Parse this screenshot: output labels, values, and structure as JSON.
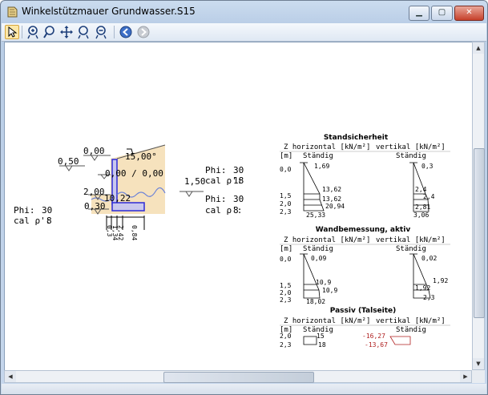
{
  "window": {
    "title": "Winkelstützmauer Grundwasser.S15",
    "min": "▁",
    "max": "▢",
    "close": "✕"
  },
  "toolbar": {
    "tools": [
      "select-tool",
      "zoom-in-tool",
      "zoom-tool",
      "pan-tool",
      "zoom-window-tool",
      "zoom-out-tool",
      "back-tool",
      "forward-tool"
    ]
  },
  "drawing": {
    "levels": {
      "left_top": "0,50",
      "wall_top": "0,00",
      "slope": "15,00°",
      "gw_mid": "0,00 / 0,00",
      "right_gw": "1,50",
      "left_gw": "2,00",
      "base_left": "0,30",
      "base_width": "10,22"
    },
    "soil_right": {
      "phi_label": "Phi:",
      "phi": "30",
      "rho_label": "cal ρ':",
      "rho": "18"
    },
    "soil_right2": {
      "phi_label": "Phi:",
      "phi": "30",
      "rho_label": "cal ρ':",
      "rho": "8"
    },
    "soil_left": {
      "phi_label": "Phi:",
      "phi": "30",
      "rho_label": "cal ρ':",
      "rho": "8"
    },
    "dims": [
      "0,3",
      "1,34",
      "2,42",
      "0,84"
    ]
  },
  "panels": [
    {
      "title": "Standsicherheit",
      "col_h": "Z horizontal [kN/m²]",
      "col_v": "vertikal [kN/m²]",
      "unit": "[m]",
      "case_h": "Ständig",
      "case_v": "Ständig",
      "depths": [
        "0,0",
        "1,5",
        "2,0",
        "2,3"
      ],
      "h_values": [
        "1,69",
        "13,62",
        "13,62",
        "20,94",
        "25,33"
      ],
      "v_values": [
        "0,3",
        "2,4",
        "2,4",
        "2,81",
        "3,06"
      ]
    },
    {
      "title": "Wandbemessung, aktiv",
      "col_h": "Z horizontal [kN/m²]",
      "col_v": "vertikal [kN/m²]",
      "unit": "[m]",
      "case_h": "Ständig",
      "case_v": "Ständig",
      "depths": [
        "0,0",
        "1,5",
        "2,0",
        "2,3"
      ],
      "h_values": [
        "0,09",
        "10,9",
        "10,9",
        "18,02"
      ],
      "v_values": [
        "0,02",
        "1,92",
        "1,92",
        "2,3"
      ]
    },
    {
      "title": "Passiv (Talseite)",
      "col_h": "Z horizontal [kN/m²]",
      "col_v": "vertikal [kN/m²]",
      "unit": "[m]",
      "case_h": "Ständig",
      "case_v": "Ständig",
      "depths": [
        "2,0",
        "2,3"
      ],
      "h_values": [
        "15",
        "18"
      ],
      "v_values": [
        "-16,27",
        "-13,67"
      ]
    }
  ],
  "colors": {
    "soil": "#f6e2bd",
    "wall": "#2d2bd6",
    "wall_fill": "#c9c8ee",
    "negative": "#b02020",
    "line": "#000000"
  }
}
